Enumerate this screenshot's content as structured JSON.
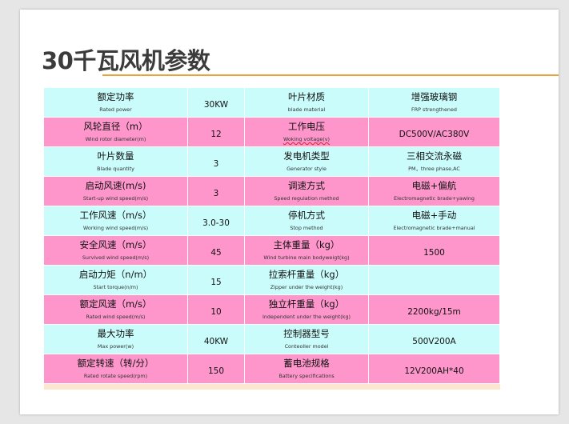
{
  "title": "30千瓦风机参数",
  "rows": [
    {
      "l_cn": "额定功率",
      "l_en": "Rated  power",
      "l_val": "30KW",
      "r_cn": "叶片材质",
      "r_en": "blade  material",
      "r_val_cn": "增强玻璃钢",
      "r_val_en": "FRP  strengthened"
    },
    {
      "l_cn": "风轮直径（m）",
      "l_en": "Wind rotor diameter(m)",
      "l_val": "12",
      "r_cn": "工作电压",
      "r_en": "Woking voltage(v)",
      "r_val_cn": "DC500V/AC380V",
      "r_val_en": ""
    },
    {
      "l_cn": "叶片数量",
      "l_en": "Blade quantity",
      "l_val": "3",
      "r_cn": "发电机类型",
      "r_en": "Generator style",
      "r_val_cn": "三相交流永磁",
      "r_val_en": "PM，three phase,AC"
    },
    {
      "l_cn": "启动风速(m/s)",
      "l_en": "Start-up wind speed(m/s)",
      "l_val": "3",
      "r_cn": "调速方式",
      "r_en": "Speed regulation method",
      "r_val_cn": "电磁+偏航",
      "r_val_en": "Electromagnetic brade+yawing"
    },
    {
      "l_cn": "工作风速（m/s）",
      "l_en": "Working wind speed(m/s)",
      "l_val": "3.0-30",
      "r_cn": "停机方式",
      "r_en": "Stop method",
      "r_val_cn": "电磁+手动",
      "r_val_en": "Electromagnetic brade+manual"
    },
    {
      "l_cn": "安全风速（m/s）",
      "l_en": "Survived wind speed(m/s)",
      "l_val": "45",
      "r_cn": "主体重量（kg）",
      "r_en": "Wind turbine main bodyweigt(kg)",
      "r_val_cn": "1500",
      "r_val_en": ""
    },
    {
      "l_cn": "启动力矩（n/m）",
      "l_en": "Start torque(n/m)",
      "l_val": "15",
      "r_cn": "拉索杆重量（kg）",
      "r_en": "Zipper under the weight(kg)",
      "r_val_cn": "",
      "r_val_en": ""
    },
    {
      "l_cn": "额定风速（m/s）",
      "l_en": "Rated wind speed(m/s)",
      "l_val": "10",
      "r_cn": "独立杆重量（kg）",
      "r_en": "Independent under the weight(kg)",
      "r_val_cn": "2200kg/15m",
      "r_val_en": ""
    },
    {
      "l_cn": "最大功率",
      "l_en": "Max power(w)",
      "l_val": "40KW",
      "r_cn": "控制器型号",
      "r_en": "Conteoller model",
      "r_val_cn": "500V200A",
      "r_val_en": ""
    },
    {
      "l_cn": "额定转速（转/分）",
      "l_en": "Rated rotate speed(rpm)",
      "l_val": "150",
      "r_cn": "蓄电池规格",
      "r_en": "Battery specifications",
      "r_val_cn": "12V200AH*40",
      "r_val_en": ""
    }
  ],
  "colors": {
    "row_cyan": "#c9fcfb",
    "row_pink": "#fe96cc",
    "title_rule": "#e8a33a"
  }
}
